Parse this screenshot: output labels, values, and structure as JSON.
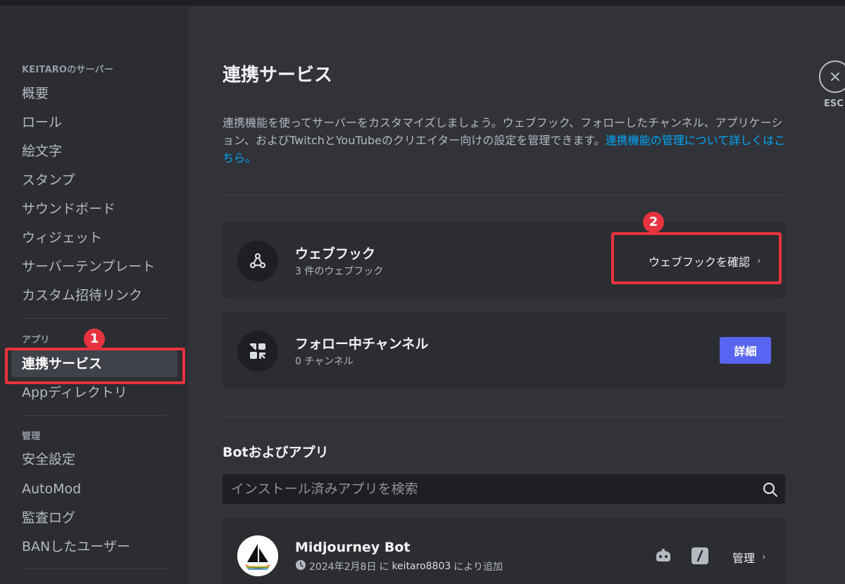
{
  "sidebar": {
    "server_header": "KEITAROのサーバー",
    "server_items": [
      "概要",
      "ロール",
      "絵文字",
      "スタンプ",
      "サウンドボード",
      "ウィジェット",
      "サーバーテンプレート",
      "カスタム招待リンク"
    ],
    "apps_header": "アプリ",
    "active_item": "連携サービス",
    "app_directory": "Appディレクトリ",
    "manage_header": "管理",
    "manage_items": [
      "安全設定",
      "AutoMod",
      "監査ログ",
      "BANしたユーザー"
    ]
  },
  "annotations": {
    "badge1": "1",
    "badge2": "2",
    "highlight_color": "#e8323f"
  },
  "main": {
    "title": "連携サービス",
    "description": "連携機能を使ってサーバーをカスタマイズしましょう。ウェブフック、フォローしたチャンネル、アプリケーション、およびTwitchとYouTubeのクリエイター向けの設定を管理できます。",
    "description_link": "連携機能の管理について詳しくはこちら。",
    "webhooks": {
      "title": "ウェブフック",
      "subtitle": "3 件のウェブフック",
      "action": "ウェブフックを確認"
    },
    "followed": {
      "title": "フォロー中チャンネル",
      "subtitle": "0 チャンネル",
      "action": "詳細"
    },
    "bots_title": "Botおよびアプリ",
    "search_placeholder": "インストール済みアプリを検索",
    "bot": {
      "name": "Midjourney Bot",
      "date": "2024年2月8日",
      "by": "に",
      "user": "keitaro8803",
      "suffix": "により追加",
      "manage": "管理"
    }
  },
  "close": {
    "label": "ESC"
  },
  "colors": {
    "accent": "#5865f2",
    "link": "#00a8fc"
  }
}
